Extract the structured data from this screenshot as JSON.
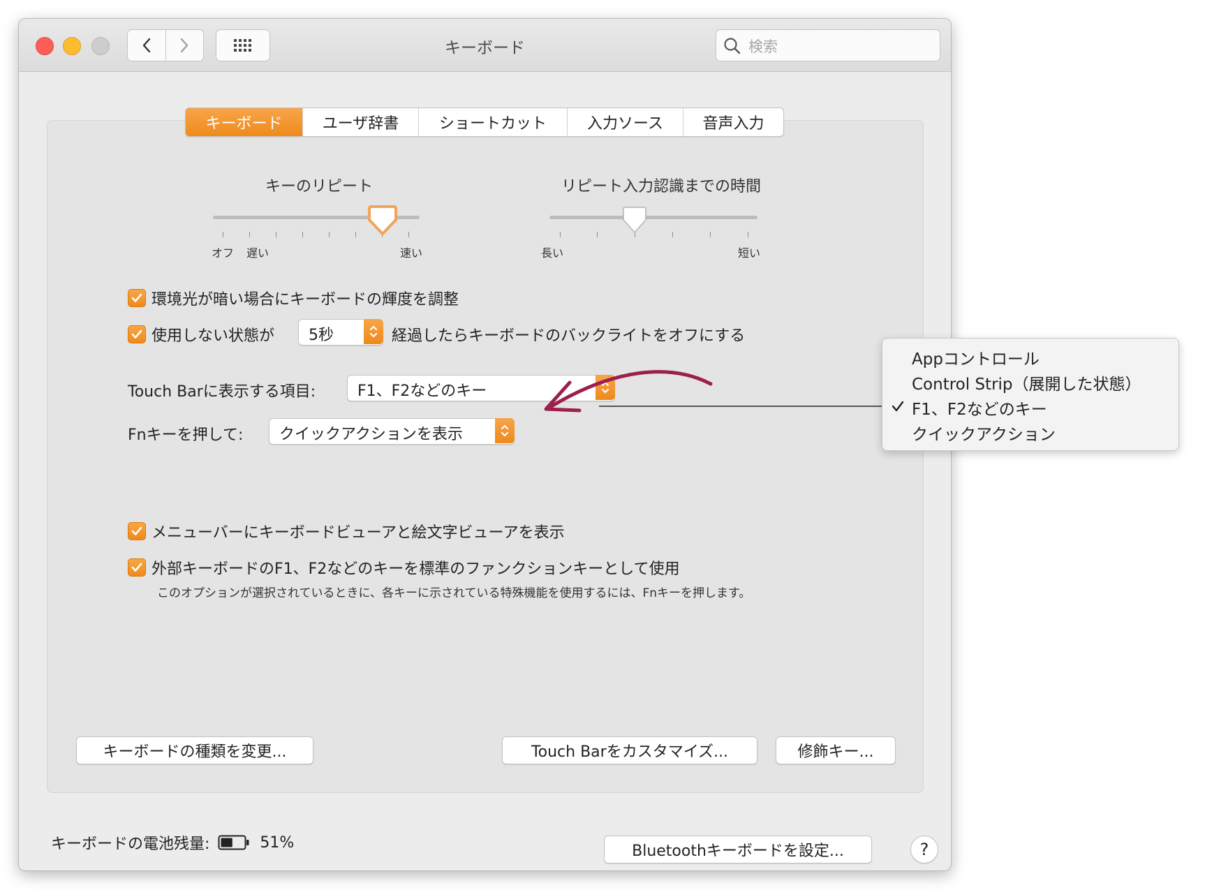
{
  "window": {
    "title": "キーボード",
    "search_placeholder": "検索"
  },
  "tabs": [
    {
      "label": "キーボード",
      "active": true
    },
    {
      "label": "ユーザ辞書",
      "active": false
    },
    {
      "label": "ショートカット",
      "active": false
    },
    {
      "label": "入力ソース",
      "active": false
    },
    {
      "label": "音声入力",
      "active": false
    }
  ],
  "key_repeat": {
    "label": "キーのリピート",
    "left_labels": [
      "オフ",
      "遅い"
    ],
    "right_label": "速い",
    "value_fraction": 0.86
  },
  "delay_until_repeat": {
    "label": "リピート入力認識までの時間",
    "left_label": "長い",
    "right_label": "短い",
    "value_fraction": 0.4
  },
  "options": {
    "adjust_brightness": {
      "label": "環境光が暗い場合にキーボードの輝度を調整",
      "checked": true
    },
    "backlight_off": {
      "label_before": "使用しない状態が",
      "value": "5秒",
      "label_after": "経過したらキーボードのバックライトをオフにする",
      "checked": true
    },
    "show_viewer": {
      "label": "メニューバーにキーボードビューアと絵文字ビューアを表示",
      "checked": true
    },
    "use_fn_keys": {
      "label": "外部キーボードのF1、F2などのキーを標準のファンクションキーとして使用",
      "note": "このオプションが選択されているときに、各キーに示されている特殊機能を使用するには、Fnキーを押します。",
      "checked": true
    }
  },
  "touch_bar": {
    "label": "Touch Barに表示する項目:",
    "value": "F1、F2などのキー"
  },
  "fn_key": {
    "label": "Fnキーを押して:",
    "value": "クイックアクションを表示"
  },
  "buttons": {
    "change_keyboard_type": "キーボードの種類を変更...",
    "customize_touch_bar": "Touch Barをカスタマイズ...",
    "modifier_keys": "修飾キー...",
    "setup_bluetooth": "Bluetoothキーボードを設定...",
    "help": "?"
  },
  "battery": {
    "label": "キーボードの電池残量:",
    "value": "51%",
    "level_fraction": 0.51
  },
  "touch_bar_menu": {
    "items": [
      {
        "label": "Appコントロール",
        "checked": false
      },
      {
        "label": "Control Strip（展開した状態）",
        "checked": false
      },
      {
        "label": "F1、F2などのキー",
        "checked": true
      },
      {
        "label": "クイックアクション",
        "checked": false
      }
    ]
  },
  "colors": {
    "accent": "#F08C1E",
    "annotation_arrow": "#9C1F4E"
  }
}
